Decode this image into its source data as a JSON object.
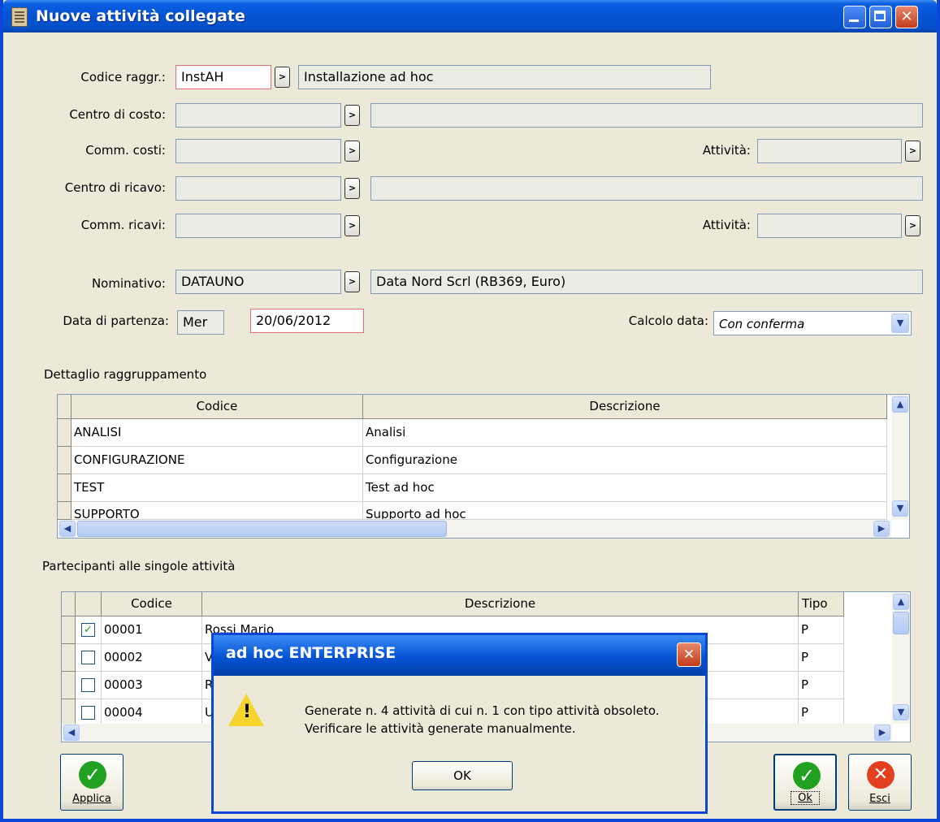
{
  "window": {
    "title": "Nuove attività collegate"
  },
  "form": {
    "codice_raggr_label": "Codice raggr.:",
    "codice_raggr_value": "InstAH",
    "codice_raggr_desc": "Installazione ad hoc",
    "centro_costo_label": "Centro di costo:",
    "comm_costi_label": "Comm. costi:",
    "attivita_label_1": "Attività:",
    "centro_ricavo_label": "Centro di ricavo:",
    "comm_ricavi_label": "Comm. ricavi:",
    "attivita_label_2": "Attività:",
    "nominativo_label": "Nominativo:",
    "nominativo_value": "DATAUNO",
    "nominativo_desc": "Data Nord Scrl  (RB369, Euro)",
    "data_partenza_label": "Data di partenza:",
    "giorno_value": "Mer",
    "data_value": "20/06/2012",
    "calcolo_data_label": "Calcolo data:",
    "calcolo_data_value": "Con conferma"
  },
  "dettaglio": {
    "title": "Dettaglio raggruppamento",
    "columns": [
      "Codice",
      "Descrizione"
    ],
    "rows": [
      {
        "codice": "ANALISI",
        "descrizione": "Analisi"
      },
      {
        "codice": "CONFIGURAZIONE",
        "descrizione": "Configurazione"
      },
      {
        "codice": "TEST",
        "descrizione": "Test ad hoc"
      },
      {
        "codice": "SUPPORTO",
        "descrizione": "Supporto ad hoc"
      }
    ]
  },
  "partecipanti": {
    "title": "Partecipanti alle singole attività",
    "columns": [
      "Codice",
      "Descrizione",
      "Tipo"
    ],
    "rows": [
      {
        "checked": true,
        "codice": "00001",
        "descrizione": "Rossi Mario",
        "tipo": "P"
      },
      {
        "checked": false,
        "codice": "00002",
        "descrizione": "V",
        "tipo": "P"
      },
      {
        "checked": false,
        "codice": "00003",
        "descrizione": "R",
        "tipo": "P"
      },
      {
        "checked": false,
        "codice": "00004",
        "descrizione": "U",
        "tipo": "P"
      }
    ]
  },
  "buttons": {
    "applica": "Applica",
    "ok": "Ok",
    "esci": "Esci"
  },
  "dialog": {
    "title": "ad hoc ENTERPRISE",
    "line1": "Generate n. 4 attività di cui n. 1 con tipo attività obsoleto.",
    "line2": "Verificare le attività generate manualmente.",
    "ok_label": "OK"
  },
  "icons": {
    "window": "form-icon",
    "zoom": "zoom-arrow-icon",
    "apply": "check-icon",
    "exit": "cancel-icon",
    "warning": "warning-icon"
  },
  "colors": {
    "titlebar": "#0553d4",
    "required_border": "#e06c74",
    "check_green": "#21a121",
    "exit_red": "#e3401f"
  }
}
